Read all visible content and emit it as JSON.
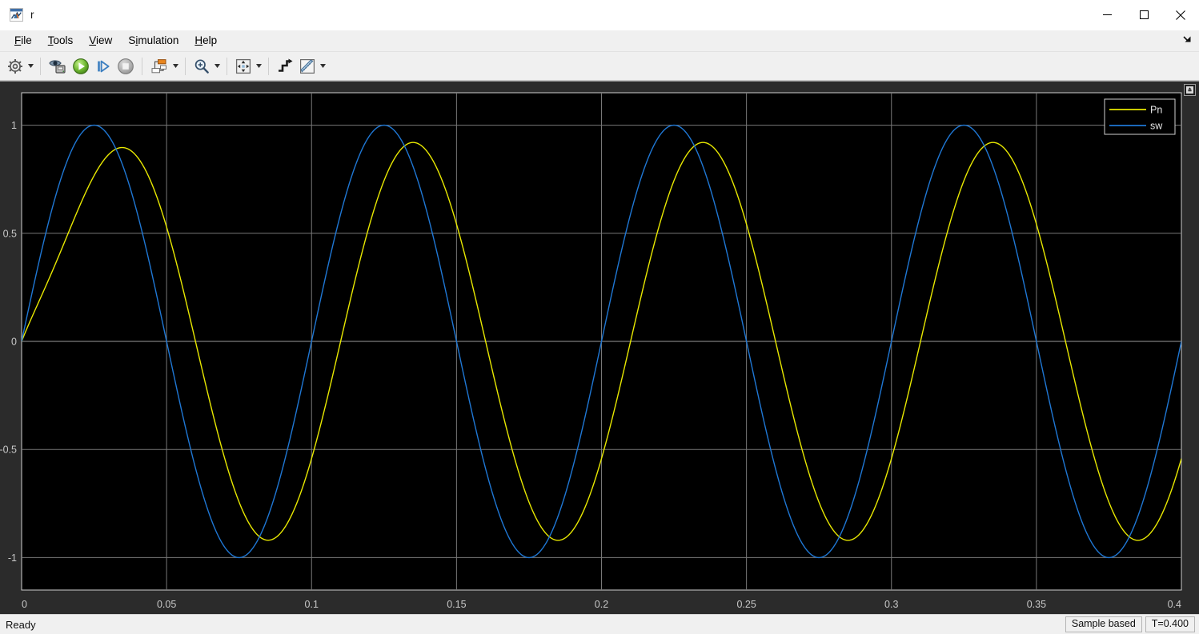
{
  "window": {
    "title": "r",
    "app_icon": "matlab-simulink-scope-icon",
    "controls": [
      {
        "name": "minimize-button",
        "glyph": "minimize-icon"
      },
      {
        "name": "maximize-button",
        "glyph": "maximize-icon"
      },
      {
        "name": "close-button",
        "glyph": "close-icon"
      }
    ]
  },
  "menubar": {
    "items": [
      {
        "label": "File",
        "mnemonic": "F"
      },
      {
        "label": "Tools",
        "mnemonic": "T"
      },
      {
        "label": "View",
        "mnemonic": "V"
      },
      {
        "label": "Simulation",
        "mnemonic": "i"
      },
      {
        "label": "Help",
        "mnemonic": "H"
      }
    ],
    "collapse_icon": "collapse-arrow-icon"
  },
  "toolbar": {
    "buttons": [
      {
        "name": "configuration-properties-button",
        "icon": "gear-icon",
        "has_caret": true
      },
      {
        "name": "print-button",
        "icon": "print-preview-icon",
        "has_caret": false
      },
      {
        "name": "run-button",
        "icon": "play-icon",
        "has_caret": false
      },
      {
        "name": "step-forward-button",
        "icon": "step-forward-icon",
        "has_caret": false
      },
      {
        "name": "stop-button",
        "icon": "stop-icon",
        "has_caret": false
      },
      {
        "name": "signal-selection-button",
        "icon": "signal-blocks-icon",
        "has_caret": true
      },
      {
        "name": "zoom-button",
        "icon": "magnifier-plus-icon",
        "has_caret": true
      },
      {
        "name": "autoscale-button",
        "icon": "autoscale-arrows-icon",
        "has_caret": true
      },
      {
        "name": "trigger-button",
        "icon": "trigger-step-icon",
        "has_caret": false
      },
      {
        "name": "cursor-measurements-button",
        "icon": "ruler-icon",
        "has_caret": true
      }
    ]
  },
  "statusbar": {
    "ready_text": "Ready",
    "frame_mode": "Sample based",
    "time": "T=0.400"
  },
  "plot": {
    "scroll_pin_icon": "scroll-to-top-icon",
    "legend_position": "top-right"
  },
  "colors": {
    "plot_background": "#000000",
    "axes_background": "#2b2b2b",
    "grid": "#787878",
    "axis_text": "#c8c8c8",
    "series_pn": "#e8e800",
    "series_sw": "#1f77d4",
    "legend_border": "#d0d0d0",
    "window_chrome": "#f0f0f0"
  },
  "chart_data": {
    "type": "line",
    "title": "",
    "xlabel": "",
    "ylabel": "",
    "xlim": [
      0,
      0.4
    ],
    "ylim": [
      -1.15,
      1.15
    ],
    "xticks": [
      0,
      0.05,
      0.1,
      0.15,
      0.2,
      0.25,
      0.3,
      0.35,
      0.4
    ],
    "xticklabels": [
      "0",
      "0.05",
      "0.1",
      "0.15",
      "0.2",
      "0.25",
      "0.3",
      "0.35",
      "0.4"
    ],
    "yticks": [
      1,
      0.5,
      0,
      -0.5,
      -1
    ],
    "yticklabels": [
      "1",
      "0.5",
      "0",
      "-0.5",
      "-1"
    ],
    "grid": true,
    "legend": [
      "Pn",
      "sw"
    ],
    "legend_position": "upper right",
    "series": [
      {
        "name": "sw",
        "color": "#1f77d4",
        "kind": "sine",
        "amplitude": 1.0,
        "frequency_hz": 10,
        "phase_rad": 0,
        "description": "Pure sine wave, amplitude 1, period 0.1 s, starts at 0 rising"
      },
      {
        "name": "Pn",
        "color": "#e8e800",
        "kind": "filtered-sine",
        "amplitude": 0.92,
        "frequency_hz": 10,
        "phase_lag_rad": 0.63,
        "undershoot": -0.07,
        "settle_time": 0.012,
        "description": "Phase-lagged filtered sine, peak 0.92, trough -0.93, initial undershoot to -0.07 near t=0.004"
      }
    ],
    "sample_points_sw": [
      {
        "t": 0.0,
        "y": 0.0
      },
      {
        "t": 0.025,
        "y": 1.0
      },
      {
        "t": 0.05,
        "y": 0.0
      },
      {
        "t": 0.075,
        "y": -1.0
      },
      {
        "t": 0.1,
        "y": 0.0
      },
      {
        "t": 0.125,
        "y": 1.0
      },
      {
        "t": 0.15,
        "y": 0.0
      },
      {
        "t": 0.175,
        "y": -1.0
      },
      {
        "t": 0.2,
        "y": 0.0
      },
      {
        "t": 0.225,
        "y": 1.0
      },
      {
        "t": 0.25,
        "y": 0.0
      },
      {
        "t": 0.275,
        "y": -1.0
      },
      {
        "t": 0.3,
        "y": 0.0
      },
      {
        "t": 0.325,
        "y": 1.0
      },
      {
        "t": 0.35,
        "y": 0.0
      },
      {
        "t": 0.375,
        "y": -1.0
      },
      {
        "t": 0.4,
        "y": 0.0
      }
    ],
    "sample_points_pn": [
      {
        "t": 0.0,
        "y": 0.0
      },
      {
        "t": 0.004,
        "y": -0.07
      },
      {
        "t": 0.009,
        "y": 0.0
      },
      {
        "t": 0.033,
        "y": 0.92
      },
      {
        "t": 0.058,
        "y": 0.0
      },
      {
        "t": 0.082,
        "y": -0.93
      },
      {
        "t": 0.108,
        "y": 0.0
      },
      {
        "t": 0.133,
        "y": 0.92
      },
      {
        "t": 0.158,
        "y": 0.0
      },
      {
        "t": 0.183,
        "y": -0.93
      },
      {
        "t": 0.208,
        "y": 0.0
      },
      {
        "t": 0.233,
        "y": 0.92
      },
      {
        "t": 0.258,
        "y": 0.0
      },
      {
        "t": 0.283,
        "y": -0.93
      },
      {
        "t": 0.308,
        "y": 0.0
      },
      {
        "t": 0.333,
        "y": 0.92
      },
      {
        "t": 0.358,
        "y": 0.0
      },
      {
        "t": 0.383,
        "y": -0.93
      },
      {
        "t": 0.4,
        "y": -0.48
      }
    ]
  }
}
